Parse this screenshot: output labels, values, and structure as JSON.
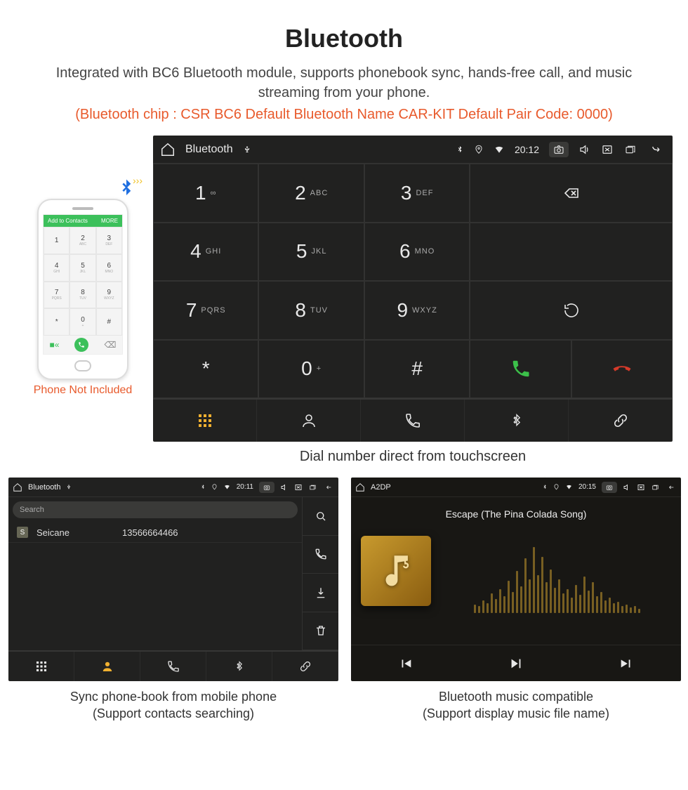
{
  "hero": {
    "title": "Bluetooth",
    "subtitle": "Integrated with BC6 Bluetooth module, supports phonebook sync, hands-free call, and music streaming from your phone.",
    "specs": "(Bluetooth chip : CSR BC6     Default Bluetooth Name CAR-KIT     Default Pair Code: 0000)"
  },
  "phone": {
    "top_add": "Add to Contacts",
    "top_more": "MORE",
    "caption": "Phone Not Included",
    "keys": [
      {
        "d": "1",
        "s": ""
      },
      {
        "d": "2",
        "s": "ABC"
      },
      {
        "d": "3",
        "s": "DEF"
      },
      {
        "d": "4",
        "s": "GHI"
      },
      {
        "d": "5",
        "s": "JKL"
      },
      {
        "d": "6",
        "s": "MNO"
      },
      {
        "d": "7",
        "s": "PQRS"
      },
      {
        "d": "8",
        "s": "TUV"
      },
      {
        "d": "9",
        "s": "WXYZ"
      },
      {
        "d": "*",
        "s": ""
      },
      {
        "d": "0",
        "s": "+"
      },
      {
        "d": "#",
        "s": ""
      }
    ]
  },
  "dialer": {
    "status_title": "Bluetooth",
    "time": "20:12",
    "keys": [
      {
        "d": "1",
        "s": "∞"
      },
      {
        "d": "2",
        "s": "ABC"
      },
      {
        "d": "3",
        "s": "DEF"
      },
      {
        "d": "4",
        "s": "GHI"
      },
      {
        "d": "5",
        "s": "JKL"
      },
      {
        "d": "6",
        "s": "MNO"
      },
      {
        "d": "7",
        "s": "PQRS"
      },
      {
        "d": "8",
        "s": "TUV"
      },
      {
        "d": "9",
        "s": "WXYZ"
      },
      {
        "d": "*",
        "s": ""
      },
      {
        "d": "0",
        "s": "+"
      },
      {
        "d": "#",
        "s": ""
      }
    ],
    "caption": "Dial number direct from touchscreen"
  },
  "contacts": {
    "status_title": "Bluetooth",
    "time": "20:11",
    "search_placeholder": "Search",
    "row_badge": "S",
    "row_name": "Seicane",
    "row_number": "13566664466",
    "caption_l1": "Sync phone-book from mobile phone",
    "caption_l2": "(Support contacts searching)"
  },
  "a2dp": {
    "status_title": "A2DP",
    "time": "20:15",
    "song": "Escape (The Pina Colada Song)",
    "caption_l1": "Bluetooth music compatible",
    "caption_l2": "(Support display music file name)"
  }
}
